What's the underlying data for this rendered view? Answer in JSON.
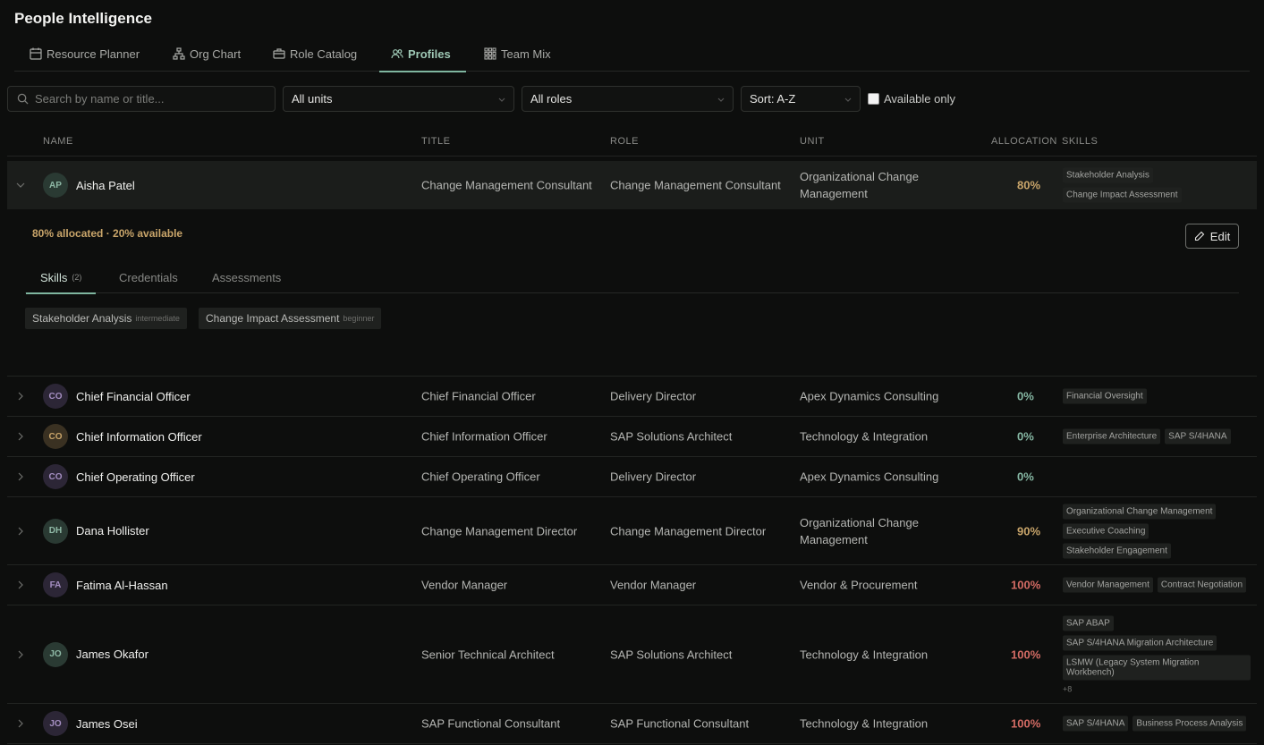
{
  "app": {
    "title": "People Intelligence"
  },
  "tabs": [
    {
      "label": "Resource Planner",
      "icon": "calendar-icon"
    },
    {
      "label": "Org Chart",
      "icon": "org-chart-icon"
    },
    {
      "label": "Role Catalog",
      "icon": "briefcase-icon"
    },
    {
      "label": "Profiles",
      "icon": "users-icon",
      "active": true
    },
    {
      "label": "Team Mix",
      "icon": "grid-icon"
    }
  ],
  "filters": {
    "search_placeholder": "Search by name or title...",
    "unit": "All units",
    "role": "All roles",
    "sort": "Sort: A-Z",
    "available_only_label": "Available only",
    "available_only_checked": false
  },
  "columns": {
    "name": "NAME",
    "title": "TITLE",
    "role": "ROLE",
    "unit": "UNIT",
    "allocation": "ALLOCATION",
    "skills": "SKILLS"
  },
  "expanded": {
    "allocation_summary": "80% allocated · 20% available",
    "edit_label": "Edit",
    "tabs": {
      "skills": "Skills",
      "skills_count": "(2)",
      "credentials": "Credentials",
      "assessments": "Assessments"
    },
    "skills": [
      {
        "name": "Stakeholder Analysis",
        "level": "intermediate"
      },
      {
        "name": "Change Impact Assessment",
        "level": "beginner"
      }
    ]
  },
  "people": [
    {
      "initials": "AP",
      "name": "Aisha Patel",
      "title": "Change Management Consultant",
      "role": "Change Management Consultant",
      "unit": "Organizational Change Management",
      "allocation": "80%",
      "alloc_color": "#c9a56a",
      "avatar_bg": "#2a3a33",
      "avatar_fg": "#8fb9a6",
      "skills": [
        "Stakeholder Analysis",
        "Change Impact Assessment"
      ],
      "more": ""
    },
    {
      "initials": "CO",
      "name": "Chief Financial Officer",
      "title": "Chief Financial Officer",
      "role": "Delivery Director",
      "unit": "Apex Dynamics Consulting",
      "allocation": "0%",
      "alloc_color": "#86b8a4",
      "avatar_bg": "#2c2636",
      "avatar_fg": "#a58fc2",
      "skills": [
        "Financial Oversight"
      ],
      "more": ""
    },
    {
      "initials": "CO",
      "name": "Chief Information Officer",
      "title": "Chief Information Officer",
      "role": "SAP Solutions Architect",
      "unit": "Technology & Integration",
      "allocation": "0%",
      "alloc_color": "#86b8a4",
      "avatar_bg": "#3a3122",
      "avatar_fg": "#c9a56a",
      "skills": [
        "Enterprise Architecture",
        "SAP S/4HANA"
      ],
      "more": ""
    },
    {
      "initials": "CO",
      "name": "Chief Operating Officer",
      "title": "Chief Operating Officer",
      "role": "Delivery Director",
      "unit": "Apex Dynamics Consulting",
      "allocation": "0%",
      "alloc_color": "#86b8a4",
      "avatar_bg": "#2c2636",
      "avatar_fg": "#a58fc2",
      "skills": [],
      "more": ""
    },
    {
      "initials": "DH",
      "name": "Dana Hollister",
      "title": "Change Management Director",
      "role": "Change Management Director",
      "unit": "Organizational Change Management",
      "allocation": "90%",
      "alloc_color": "#c9a56a",
      "avatar_bg": "#2a3a33",
      "avatar_fg": "#8fb9a6",
      "skills": [
        "Organizational Change Management",
        "Executive Coaching",
        "Stakeholder Engagement"
      ],
      "more": ""
    },
    {
      "initials": "FA",
      "name": "Fatima Al-Hassan",
      "title": "Vendor Manager",
      "role": "Vendor Manager",
      "unit": "Vendor & Procurement",
      "allocation": "100%",
      "alloc_color": "#d36b64",
      "avatar_bg": "#2c2636",
      "avatar_fg": "#a58fc2",
      "skills": [
        "Vendor Management",
        "Contract Negotiation"
      ],
      "more": ""
    },
    {
      "initials": "JO",
      "name": "James Okafor",
      "title": "Senior Technical Architect",
      "role": "SAP Solutions Architect",
      "unit": "Technology & Integration",
      "allocation": "100%",
      "alloc_color": "#d36b64",
      "avatar_bg": "#2a3a33",
      "avatar_fg": "#8fb9a6",
      "skills": [
        "SAP ABAP",
        "SAP S/4HANA Migration Architecture",
        "LSMW (Legacy System Migration Workbench)"
      ],
      "more": "+8"
    },
    {
      "initials": "JO",
      "name": "James Osei",
      "title": "SAP Functional Consultant",
      "role": "SAP Functional Consultant",
      "unit": "Technology & Integration",
      "allocation": "100%",
      "alloc_color": "#d36b64",
      "avatar_bg": "#2c2636",
      "avatar_fg": "#a58fc2",
      "skills": [
        "SAP S/4HANA",
        "Business Process Analysis"
      ],
      "more": ""
    }
  ]
}
